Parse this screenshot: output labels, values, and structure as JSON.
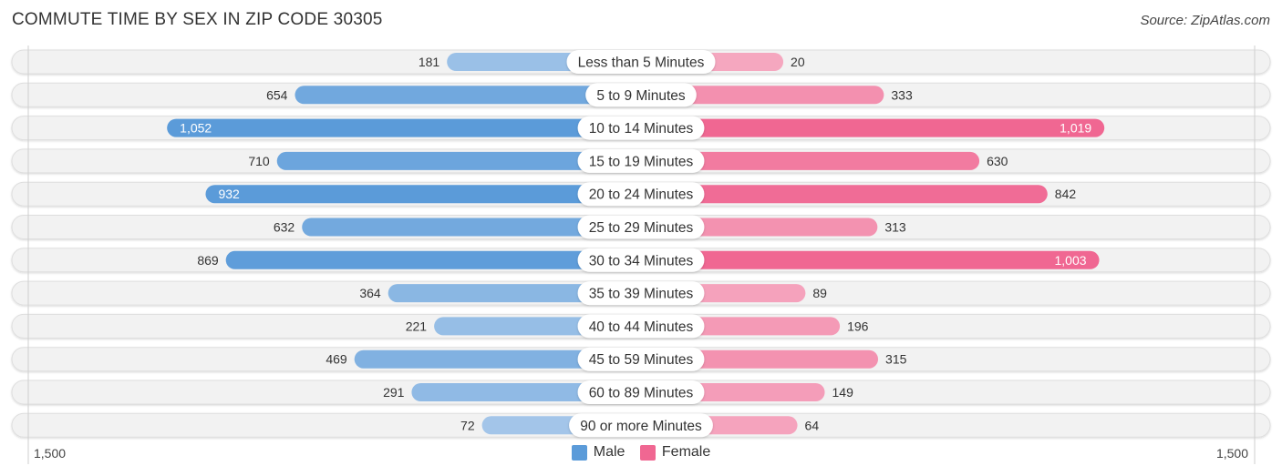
{
  "header": {
    "title": "COMMUTE TIME BY SEX IN ZIP CODE 30305",
    "source": "Source: ZipAtlas.com"
  },
  "colors": {
    "male_strong": "#5b9bd9",
    "male_light": "#a9c9ea",
    "female_strong": "#f06792",
    "female_light": "#f5a8c0",
    "row_bg": "#f2f2f2",
    "label_bg": "#ffffff"
  },
  "chart_data": {
    "type": "bar",
    "orientation": "horizontal-diverging",
    "title": "COMMUTE TIME BY SEX IN ZIP CODE 30305",
    "categories": [
      "Less than 5 Minutes",
      "5 to 9 Minutes",
      "10 to 14 Minutes",
      "15 to 19 Minutes",
      "20 to 24 Minutes",
      "25 to 29 Minutes",
      "30 to 34 Minutes",
      "35 to 39 Minutes",
      "40 to 44 Minutes",
      "45 to 59 Minutes",
      "60 to 89 Minutes",
      "90 or more Minutes"
    ],
    "series": [
      {
        "name": "Male",
        "side": "left",
        "values": [
          181,
          654,
          1052,
          710,
          932,
          632,
          869,
          364,
          221,
          469,
          291,
          72
        ]
      },
      {
        "name": "Female",
        "side": "right",
        "values": [
          20,
          333,
          1019,
          630,
          842,
          313,
          1003,
          89,
          196,
          315,
          149,
          64
        ]
      }
    ],
    "value_labels": {
      "Male": [
        "181",
        "654",
        "1,052",
        "710",
        "932",
        "632",
        "869",
        "364",
        "221",
        "469",
        "291",
        "72"
      ],
      "Female": [
        "20",
        "333",
        "1,019",
        "630",
        "842",
        "313",
        "1,003",
        "89",
        "196",
        "315",
        "149",
        "64"
      ]
    },
    "axis": {
      "left_label": "1,500",
      "right_label": "1,500",
      "max": 1500
    },
    "legend": {
      "position": "bottom-center",
      "entries": [
        "Male",
        "Female"
      ]
    },
    "xlabel": "",
    "ylabel": ""
  }
}
